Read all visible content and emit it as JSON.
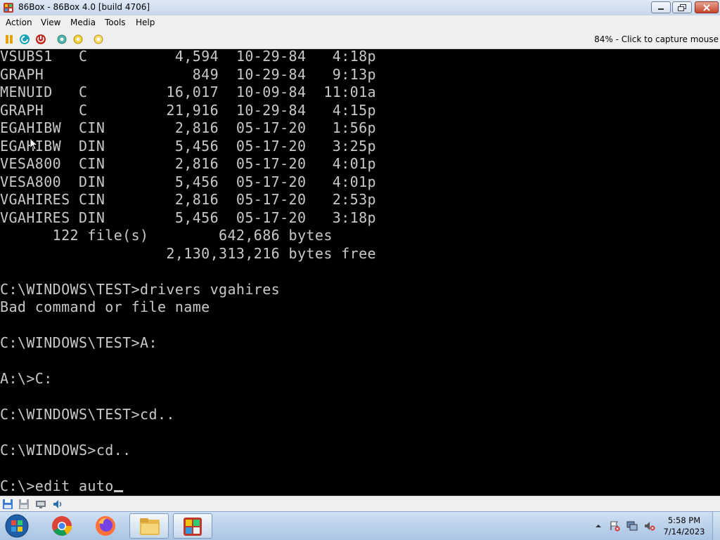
{
  "window": {
    "title": "86Box - 86Box 4.0 [build 4706]",
    "icon": "86box-app-icon",
    "controls": [
      "minimize",
      "maximize",
      "close"
    ]
  },
  "menu": {
    "items": [
      {
        "label": "Action"
      },
      {
        "label": "View"
      },
      {
        "label": "Media"
      },
      {
        "label": "Tools"
      },
      {
        "label": "Help"
      }
    ]
  },
  "toolbar": {
    "icons": [
      "pause-icon",
      "reset-icon",
      "power-icon",
      "settings-icon",
      "settings-icon-2",
      "settings-icon-3"
    ],
    "capture_text": "84% - Click to capture mouse"
  },
  "screen": {
    "lines": [
      "VSUBS1   C          4,594  10-29-84   4:18p",
      "GRAPH                 849  10-29-84   9:13p",
      "MENUID   C         16,017  10-09-84  11:01a",
      "GRAPH    C         21,916  10-29-84   4:15p",
      "EGAHIBW  CIN        2,816  05-17-20   1:56p",
      "EGAHIBW  DIN        5,456  05-17-20   3:25p",
      "VESA800  CIN        2,816  05-17-20   4:01p",
      "VESA800  DIN        5,456  05-17-20   4:01p",
      "VGAHIRES CIN        2,816  05-17-20   2:53p",
      "VGAHIRES DIN        5,456  05-17-20   3:18p",
      "      122 file(s)        642,686 bytes",
      "                   2,130,313,216 bytes free",
      "",
      "C:\\WINDOWS\\TEST>drivers vgahires",
      "Bad command or file name",
      "",
      "C:\\WINDOWS\\TEST>A:",
      "",
      "A:\\>C:",
      "",
      "C:\\WINDOWS\\TEST>cd..",
      "",
      "C:\\WINDOWS>cd..",
      ""
    ],
    "prompt_line": "C:\\>edit auto"
  },
  "statusbar": {
    "icons": [
      "floppy-icon",
      "floppy-icon-2",
      "network-icon",
      "sound-icon"
    ]
  },
  "taskbar": {
    "start_icon": "windows-start-icon",
    "apps": [
      "chrome-icon",
      "firefox-icon",
      "file-explorer-icon",
      "86box-taskbar-icon"
    ],
    "tray": [
      "show-hidden-icons-chevron",
      "action-center-icon",
      "network-icon",
      "volume-muted-icon"
    ],
    "time": "5:58 PM",
    "date": "7/14/2023"
  }
}
